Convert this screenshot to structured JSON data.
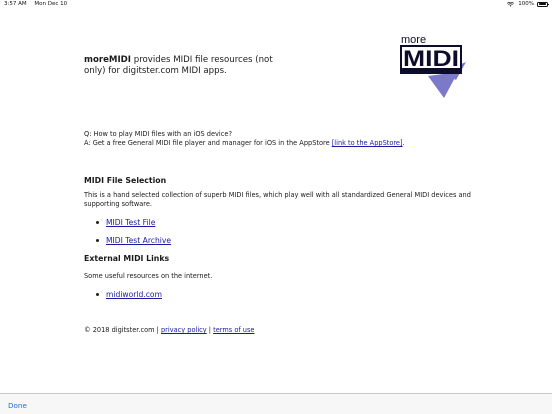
{
  "status_bar": {
    "time": "3:57 AM",
    "date": "Mon Dec 10",
    "battery_pct": "100%",
    "battery_level": 1.0,
    "icons": [
      "wifi-icon",
      "battery-icon"
    ]
  },
  "intro": {
    "brand": "moreMIDI",
    "text": " provides MIDI file resources (not only) for digitster.com MIDI apps."
  },
  "logo": {
    "small_text": "more",
    "big_text": "MIDI",
    "colors": {
      "ink": "#0d0d2b",
      "accent": "#7b79c8"
    }
  },
  "qa": {
    "question": "Q: How to play MIDI files with an iOS device?",
    "answer_prefix": "A: Get a free General MIDI file player and manager for iOS in the AppStore ",
    "answer_link": "[link to the AppStore]",
    "answer_suffix": "."
  },
  "midi_files": {
    "title": "MIDI File Selection",
    "description": "This is a hand selected collection of superb MIDI files, which play well with all standardized General MIDI devices and supporting software.",
    "links": [
      "MIDI Test File",
      "MIDI Test Archive"
    ]
  },
  "external": {
    "title": "External MIDI Links",
    "description": "Some useful resources on the internet.",
    "links": [
      "midiworld.com"
    ]
  },
  "footer": {
    "copyright": "© 2018 digitster.com",
    "sep1": " | ",
    "privacy": "privacy policy",
    "sep2": " | ",
    "terms": "terms of use"
  },
  "toolbar": {
    "done_label": "Done"
  },
  "colors": {
    "link": "#1a1aa6",
    "toolbar_button": "#1e6fd9"
  }
}
